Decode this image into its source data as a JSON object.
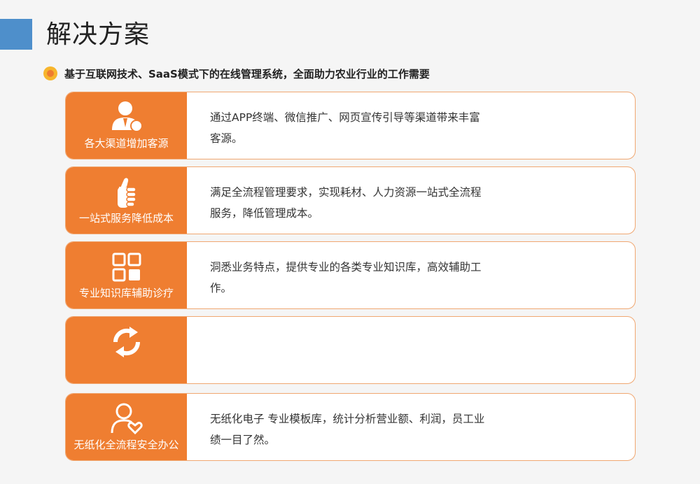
{
  "header": {
    "title": "解决方案",
    "subtitle": "基于互联网技术、SaaS模式下的在线管理系统，全面助力农业行业的工作需要"
  },
  "cards": [
    {
      "icon": "user-icon",
      "label": "各大渠道增加客源",
      "text": "通过APP终端、微信推广、网页宣传引导等渠道带来丰富客源。"
    },
    {
      "icon": "thumbs-up-icon",
      "label": "一站式服务降低成本",
      "text": "满足全流程管理要求，实现耗材、人力资源一站式全流程服务，降低管理成本。"
    },
    {
      "icon": "grid-icon",
      "label": "专业知识库辅助诊疗",
      "text": "洞悉业务特点，提供专业的各类专业知识库，高效辅助工作。"
    },
    {
      "icon": "recycle-icon",
      "label": "",
      "text": ""
    },
    {
      "icon": "user-heart-icon",
      "label": "无纸化全流程安全办公",
      "text": "无纸化电子 专业模板库，统计分析营业额、利润，员工业绩一目了然。"
    }
  ],
  "colors": {
    "accent": "#ef7e31",
    "title_bar": "#4e8fcb",
    "bullet_outer": "#f7b52c",
    "card_border": "#f0a771"
  }
}
